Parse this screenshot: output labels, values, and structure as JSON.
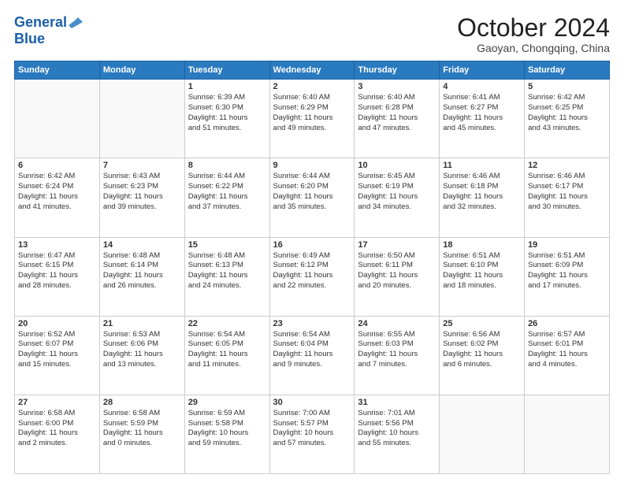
{
  "header": {
    "logo_line1": "General",
    "logo_line2": "Blue",
    "month_title": "October 2024",
    "subtitle": "Gaoyan, Chongqing, China"
  },
  "weekdays": [
    "Sunday",
    "Monday",
    "Tuesday",
    "Wednesday",
    "Thursday",
    "Friday",
    "Saturday"
  ],
  "weeks": [
    [
      {
        "day": "",
        "lines": []
      },
      {
        "day": "",
        "lines": []
      },
      {
        "day": "1",
        "lines": [
          "Sunrise: 6:39 AM",
          "Sunset: 6:30 PM",
          "Daylight: 11 hours",
          "and 51 minutes."
        ]
      },
      {
        "day": "2",
        "lines": [
          "Sunrise: 6:40 AM",
          "Sunset: 6:29 PM",
          "Daylight: 11 hours",
          "and 49 minutes."
        ]
      },
      {
        "day": "3",
        "lines": [
          "Sunrise: 6:40 AM",
          "Sunset: 6:28 PM",
          "Daylight: 11 hours",
          "and 47 minutes."
        ]
      },
      {
        "day": "4",
        "lines": [
          "Sunrise: 6:41 AM",
          "Sunset: 6:27 PM",
          "Daylight: 11 hours",
          "and 45 minutes."
        ]
      },
      {
        "day": "5",
        "lines": [
          "Sunrise: 6:42 AM",
          "Sunset: 6:25 PM",
          "Daylight: 11 hours",
          "and 43 minutes."
        ]
      }
    ],
    [
      {
        "day": "6",
        "lines": [
          "Sunrise: 6:42 AM",
          "Sunset: 6:24 PM",
          "Daylight: 11 hours",
          "and 41 minutes."
        ]
      },
      {
        "day": "7",
        "lines": [
          "Sunrise: 6:43 AM",
          "Sunset: 6:23 PM",
          "Daylight: 11 hours",
          "and 39 minutes."
        ]
      },
      {
        "day": "8",
        "lines": [
          "Sunrise: 6:44 AM",
          "Sunset: 6:22 PM",
          "Daylight: 11 hours",
          "and 37 minutes."
        ]
      },
      {
        "day": "9",
        "lines": [
          "Sunrise: 6:44 AM",
          "Sunset: 6:20 PM",
          "Daylight: 11 hours",
          "and 35 minutes."
        ]
      },
      {
        "day": "10",
        "lines": [
          "Sunrise: 6:45 AM",
          "Sunset: 6:19 PM",
          "Daylight: 11 hours",
          "and 34 minutes."
        ]
      },
      {
        "day": "11",
        "lines": [
          "Sunrise: 6:46 AM",
          "Sunset: 6:18 PM",
          "Daylight: 11 hours",
          "and 32 minutes."
        ]
      },
      {
        "day": "12",
        "lines": [
          "Sunrise: 6:46 AM",
          "Sunset: 6:17 PM",
          "Daylight: 11 hours",
          "and 30 minutes."
        ]
      }
    ],
    [
      {
        "day": "13",
        "lines": [
          "Sunrise: 6:47 AM",
          "Sunset: 6:15 PM",
          "Daylight: 11 hours",
          "and 28 minutes."
        ]
      },
      {
        "day": "14",
        "lines": [
          "Sunrise: 6:48 AM",
          "Sunset: 6:14 PM",
          "Daylight: 11 hours",
          "and 26 minutes."
        ]
      },
      {
        "day": "15",
        "lines": [
          "Sunrise: 6:48 AM",
          "Sunset: 6:13 PM",
          "Daylight: 11 hours",
          "and 24 minutes."
        ]
      },
      {
        "day": "16",
        "lines": [
          "Sunrise: 6:49 AM",
          "Sunset: 6:12 PM",
          "Daylight: 11 hours",
          "and 22 minutes."
        ]
      },
      {
        "day": "17",
        "lines": [
          "Sunrise: 6:50 AM",
          "Sunset: 6:11 PM",
          "Daylight: 11 hours",
          "and 20 minutes."
        ]
      },
      {
        "day": "18",
        "lines": [
          "Sunrise: 6:51 AM",
          "Sunset: 6:10 PM",
          "Daylight: 11 hours",
          "and 18 minutes."
        ]
      },
      {
        "day": "19",
        "lines": [
          "Sunrise: 6:51 AM",
          "Sunset: 6:09 PM",
          "Daylight: 11 hours",
          "and 17 minutes."
        ]
      }
    ],
    [
      {
        "day": "20",
        "lines": [
          "Sunrise: 6:52 AM",
          "Sunset: 6:07 PM",
          "Daylight: 11 hours",
          "and 15 minutes."
        ]
      },
      {
        "day": "21",
        "lines": [
          "Sunrise: 6:53 AM",
          "Sunset: 6:06 PM",
          "Daylight: 11 hours",
          "and 13 minutes."
        ]
      },
      {
        "day": "22",
        "lines": [
          "Sunrise: 6:54 AM",
          "Sunset: 6:05 PM",
          "Daylight: 11 hours",
          "and 11 minutes."
        ]
      },
      {
        "day": "23",
        "lines": [
          "Sunrise: 6:54 AM",
          "Sunset: 6:04 PM",
          "Daylight: 11 hours",
          "and 9 minutes."
        ]
      },
      {
        "day": "24",
        "lines": [
          "Sunrise: 6:55 AM",
          "Sunset: 6:03 PM",
          "Daylight: 11 hours",
          "and 7 minutes."
        ]
      },
      {
        "day": "25",
        "lines": [
          "Sunrise: 6:56 AM",
          "Sunset: 6:02 PM",
          "Daylight: 11 hours",
          "and 6 minutes."
        ]
      },
      {
        "day": "26",
        "lines": [
          "Sunrise: 6:57 AM",
          "Sunset: 6:01 PM",
          "Daylight: 11 hours",
          "and 4 minutes."
        ]
      }
    ],
    [
      {
        "day": "27",
        "lines": [
          "Sunrise: 6:58 AM",
          "Sunset: 6:00 PM",
          "Daylight: 11 hours",
          "and 2 minutes."
        ]
      },
      {
        "day": "28",
        "lines": [
          "Sunrise: 6:58 AM",
          "Sunset: 5:59 PM",
          "Daylight: 11 hours",
          "and 0 minutes."
        ]
      },
      {
        "day": "29",
        "lines": [
          "Sunrise: 6:59 AM",
          "Sunset: 5:58 PM",
          "Daylight: 10 hours",
          "and 59 minutes."
        ]
      },
      {
        "day": "30",
        "lines": [
          "Sunrise: 7:00 AM",
          "Sunset: 5:57 PM",
          "Daylight: 10 hours",
          "and 57 minutes."
        ]
      },
      {
        "day": "31",
        "lines": [
          "Sunrise: 7:01 AM",
          "Sunset: 5:56 PM",
          "Daylight: 10 hours",
          "and 55 minutes."
        ]
      },
      {
        "day": "",
        "lines": []
      },
      {
        "day": "",
        "lines": []
      }
    ]
  ]
}
